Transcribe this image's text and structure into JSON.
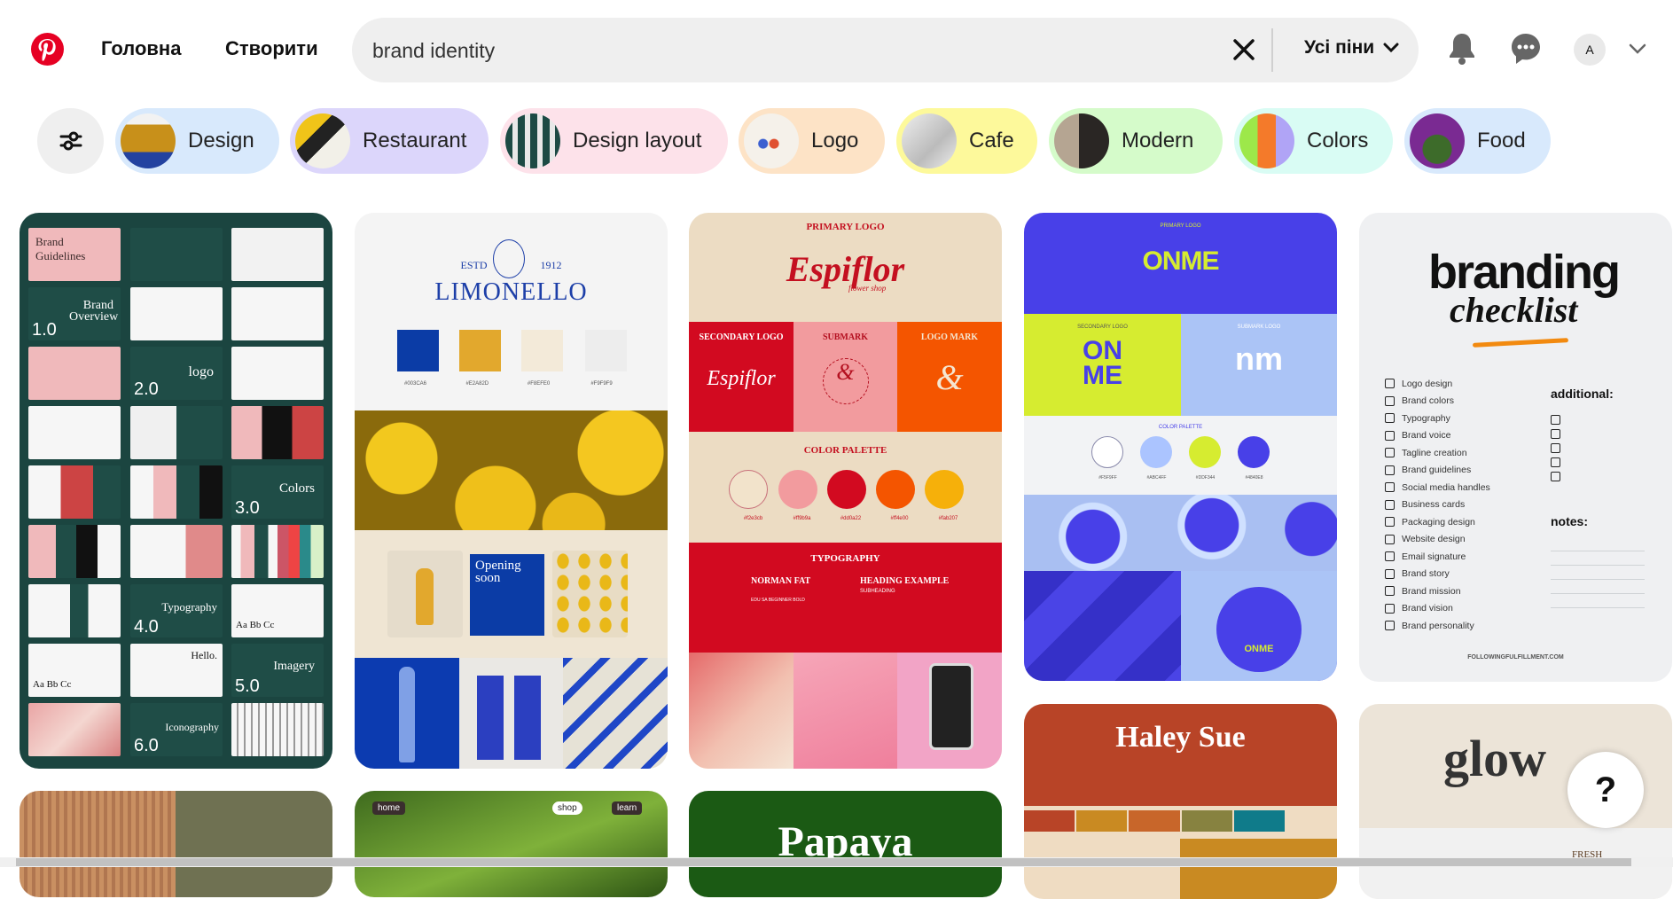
{
  "header": {
    "nav": {
      "home": "Головна",
      "create": "Створити"
    },
    "search": {
      "value": "brand identity",
      "filter_label": "Усі піни"
    },
    "avatar_letter": "A",
    "brand_color": "#e60023"
  },
  "chips": [
    {
      "label": "Design",
      "bg": "#d8e9fc"
    },
    {
      "label": "Restaurant",
      "bg": "#dcd6fb"
    },
    {
      "label": "Design layout",
      "bg": "#fde2ea"
    },
    {
      "label": "Logo",
      "bg": "#fde3c6"
    },
    {
      "label": "Cafe",
      "bg": "#fdf99b"
    },
    {
      "label": "Modern",
      "bg": "#d5fbca"
    },
    {
      "label": "Colors",
      "bg": "#d9fcf4"
    },
    {
      "label": "Food",
      "bg": "#d8e9fc"
    }
  ],
  "pins": {
    "guidelines": {
      "title": "Brand Guidelines",
      "sections": [
        {
          "num": "1.0",
          "name": "Brand Overview"
        },
        {
          "num": "2.0",
          "name": "logo"
        },
        {
          "num": "3.0",
          "name": "Colors"
        },
        {
          "num": "4.0",
          "name": "Typography"
        },
        {
          "num": "5.0",
          "name": "Imagery"
        },
        {
          "num": "6.0",
          "name": "Iconography"
        }
      ],
      "specimen": "Aa Bb Cc",
      "hello": "Hello."
    },
    "limonello": {
      "estd": "ESTD",
      "year": "1912",
      "name": "LIMONELLO",
      "swatches": [
        {
          "hex": "#003CA6",
          "color": "#0b3ca6"
        },
        {
          "hex": "#E2A82D",
          "color": "#e2a82d"
        },
        {
          "hex": "#F8EFE0",
          "color": "#f3ead9"
        },
        {
          "hex": "#F9F9F9",
          "color": "#f2f2f2"
        }
      ],
      "opening": "Opening soon"
    },
    "espiflor": {
      "primary": "PRIMARY LOGO",
      "name": "Espiflor",
      "tagline": "flower shop",
      "secondary": "SECONDARY LOGO",
      "submark": "SUBMARK",
      "logomark": "LOGO MARK",
      "palette_title": "COLOR PALETTE",
      "swatches": [
        {
          "hex": "#f2e3cb",
          "color": "#f2e3cb"
        },
        {
          "hex": "#ff9b9a",
          "color": "#f29b9e"
        },
        {
          "hex": "#dd0a22",
          "color": "#d20a20"
        },
        {
          "hex": "#ff4e00",
          "color": "#f45500"
        },
        {
          "hex": "#fab207",
          "color": "#f6b00a"
        }
      ],
      "typography": "TYPOGRAPHY",
      "font1": "NORMAN FAT",
      "font2": "HEADING EXAMPLE",
      "font1_sub": "EDU SA BEGINNER BOLD",
      "font2_sub": "SUBHEADING"
    },
    "onme": {
      "primary": "PRIMARY LOGO",
      "name": "ONME",
      "secondary": "SECONDARY LOGO",
      "submark": "SUBMARK LOGO",
      "palette_title": "COLOR PALETTE",
      "swatches": [
        {
          "hex": "#F5F9FF",
          "color": "#f5f9ff"
        },
        {
          "hex": "#ABC4FF",
          "color": "#abc4ff"
        },
        {
          "hex": "#DDF344",
          "color": "#d6ec30"
        },
        {
          "hex": "#4840E8",
          "color": "#4840e8"
        }
      ]
    },
    "checklist": {
      "title": "branding",
      "subtitle": "checklist",
      "items": [
        "Logo design",
        "Brand colors",
        "Typography",
        "Brand voice",
        "Tagline creation",
        "Brand guidelines",
        "Social media handles",
        "Business cards",
        "Packaging design",
        "Website design",
        "Email signature",
        "Brand story",
        "Brand mission",
        "Brand vision",
        "Brand personality"
      ],
      "additional": "additional:",
      "notes": "notes:",
      "footer": "FOLLOWINGFULFILLMENT.COM"
    },
    "grass": {
      "nav": [
        "home",
        "shop",
        "learn"
      ]
    },
    "papaya": {
      "name": "Papaya"
    },
    "haley": {
      "name": "Haley Sue"
    },
    "glow": {
      "name": "glow",
      "sub": "FRESH"
    }
  },
  "help_label": "?"
}
